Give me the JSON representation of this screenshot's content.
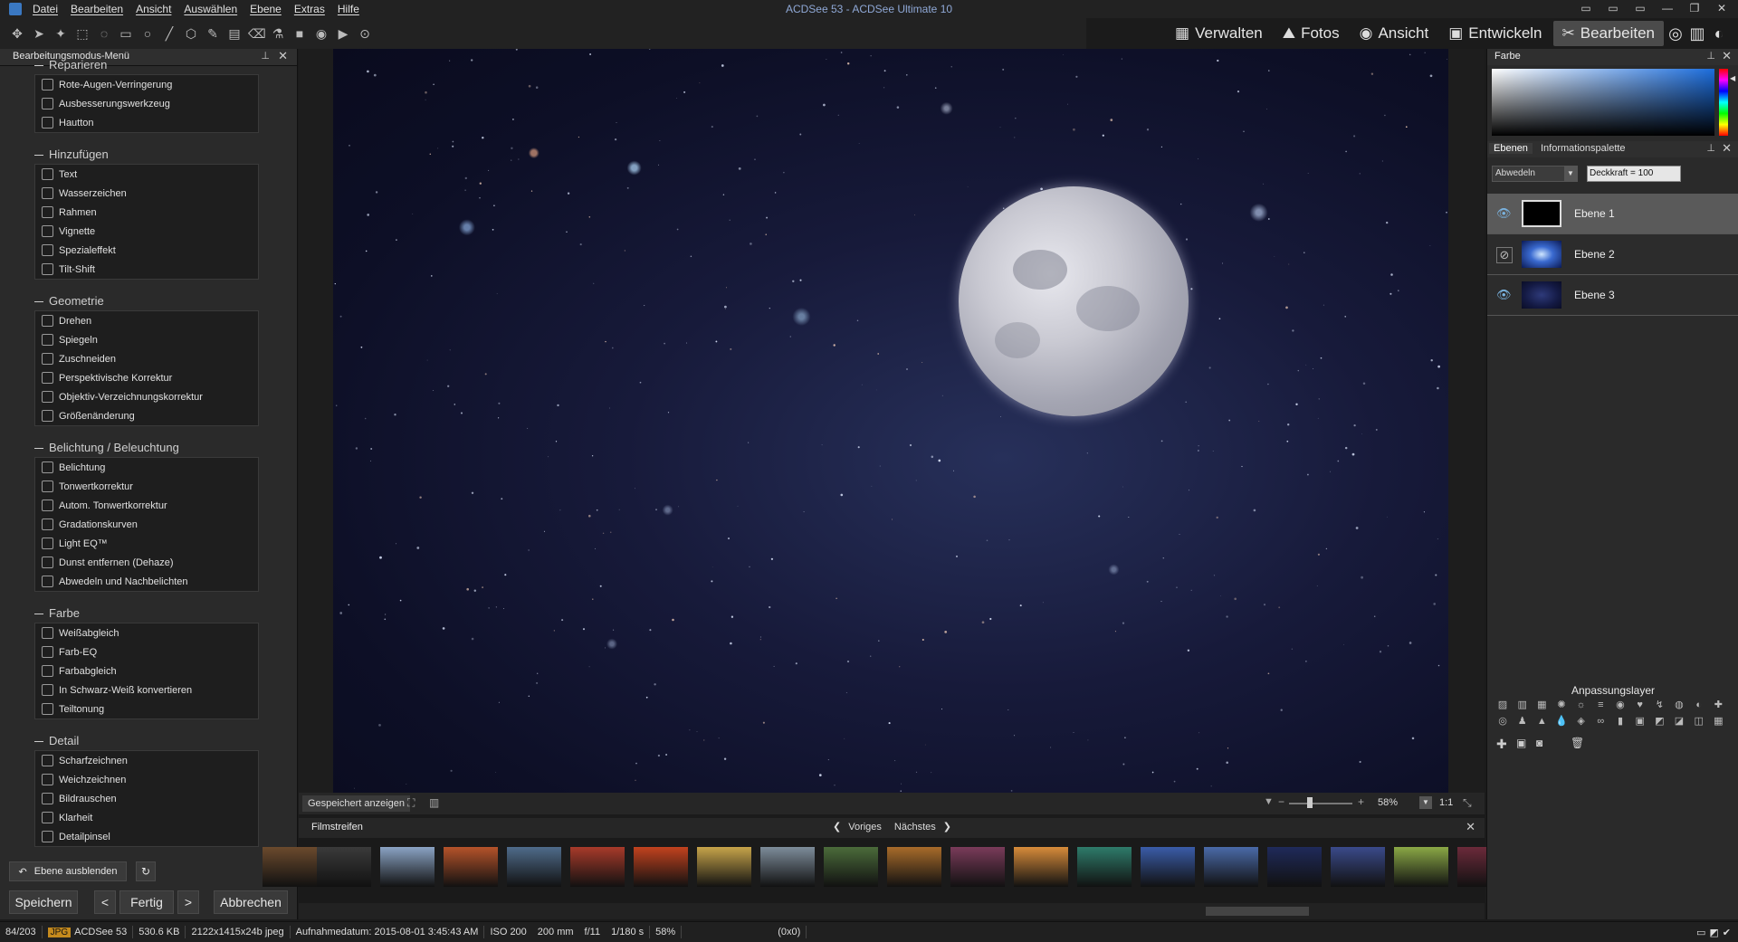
{
  "window": {
    "title": "ACDSee 53 - ACDSee Ultimate 10",
    "controls": [
      "▭",
      "▭",
      "▭",
      "—",
      "❐",
      "✕"
    ]
  },
  "menu": [
    "Datei",
    "Bearbeiten",
    "Ansicht",
    "Auswählen",
    "Ebene",
    "Extras",
    "Hilfe"
  ],
  "modes": [
    {
      "label": "Verwalten",
      "icon": "grid-icon"
    },
    {
      "label": "Fotos",
      "icon": "photos-icon"
    },
    {
      "label": "Ansicht",
      "icon": "eye-icon"
    },
    {
      "label": "Entwickeln",
      "icon": "develop-icon"
    },
    {
      "label": "Bearbeiten",
      "icon": "edit-icon",
      "active": true
    }
  ],
  "left_panel": {
    "title": "Bearbeitungsmodus-Menü",
    "sections": [
      {
        "name": "Reparieren",
        "items": [
          "Rote-Augen-Verringerung",
          "Ausbesserungswerkzeug",
          "Hautton"
        ]
      },
      {
        "name": "Hinzufügen",
        "items": [
          "Text",
          "Wasserzeichen",
          "Rahmen",
          "Vignette",
          "Spezialeffekt",
          "Tilt-Shift"
        ]
      },
      {
        "name": "Geometrie",
        "items": [
          "Drehen",
          "Spiegeln",
          "Zuschneiden",
          "Perspektivische Korrektur",
          "Objektiv-Verzeichnungskorrektur",
          "Größenänderung"
        ]
      },
      {
        "name": "Belichtung / Beleuchtung",
        "items": [
          "Belichtung",
          "Tonwertkorrektur",
          "Autom. Tonwertkorrektur",
          "Gradationskurven",
          "Light EQ™",
          "Dunst entfernen (Dehaze)",
          "Abwedeln und Nachbelichten"
        ]
      },
      {
        "name": "Farbe",
        "items": [
          "Weißabgleich",
          "Farb-EQ",
          "Farbabgleich",
          "In Schwarz-Weiß konvertieren",
          "Teiltonung"
        ]
      },
      {
        "name": "Detail",
        "items": [
          "Scharfzeichnen",
          "Weichzeichnen",
          "Bildrauschen",
          "Klarheit",
          "Detailpinsel"
        ]
      }
    ],
    "hide_layer_button": "Ebene ausblenden",
    "save_button": "Speichern",
    "done_button": "Fertig",
    "cancel_button": "Abbrechen"
  },
  "canvas": {
    "saved_button": "Gespeichert anzeigen",
    "zoom": "58%",
    "ratio": "1:1"
  },
  "filmstrip": {
    "title": "Filmstreifen",
    "prev": "Voriges",
    "next": "Nächstes",
    "thumb_colors": [
      "#6b4a2d",
      "#3a3a3a",
      "#8aa3c4",
      "#b5532a",
      "#4f6b8a",
      "#a83a2a",
      "#c2421e",
      "#c7a44a",
      "#7d8c9a",
      "#4b6b3a",
      "#a86b2a",
      "#7a3b5a",
      "#d78b3a",
      "#2e7b6a",
      "#3a5ca8",
      "#4a6aa8",
      "#1f2a5a",
      "#3a4a8a",
      "#8aa846",
      "#6b2a3a"
    ]
  },
  "right_panel": {
    "color_title": "Farbe",
    "tabs": [
      "Ebenen",
      "Informationspalette"
    ],
    "blend_mode": "Abwedeln",
    "opacity": "Deckkraft = 100",
    "layers": [
      "Ebene 1",
      "Ebene 2",
      "Ebene 3"
    ],
    "adjustment_title": "Anpassungslayer"
  },
  "status": {
    "position": "84/203",
    "format": "JPG",
    "filename": "ACDSee 53",
    "size": "530.6 KB",
    "dimensions": "2122x1415x24b jpeg",
    "date": "Aufnahmedatum: 2015-08-01 3:45:43 AM",
    "iso": "ISO 200",
    "focal": "200 mm",
    "aperture": "f/11",
    "shutter": "1/180 s",
    "zoom": "58%",
    "coords": "(0x0)"
  }
}
